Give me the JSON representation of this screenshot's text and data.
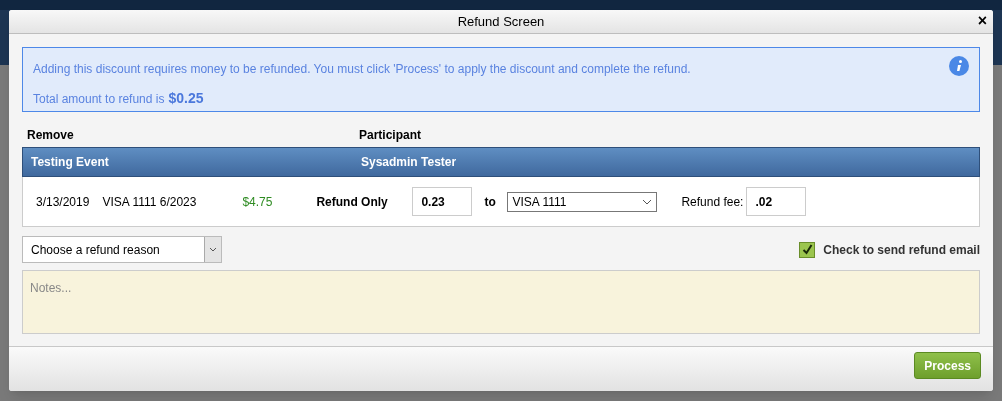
{
  "dialog": {
    "title": "Refund Screen",
    "close": "×",
    "notice": {
      "message": "Adding this discount requires money to be refunded. You must click 'Process' to apply the discount and complete the refund.",
      "total_label": "Total amount to refund is",
      "total_amount": "$0.25"
    },
    "table": {
      "columns": [
        "Remove",
        "Participant"
      ],
      "group": {
        "event": "Testing Event",
        "participant": "Sysadmin Tester"
      },
      "rows": [
        {
          "date": "3/13/2019",
          "card": "VISA 1111 6/2023",
          "amount": "$4.75",
          "action": "Refund Only",
          "refund_amount": "0.23",
          "to_label": "to",
          "destination": "VISA 1111",
          "fee_label": "Refund fee:",
          "fee": ".02"
        }
      ]
    },
    "reason": {
      "value": "Choose a refund reason"
    },
    "email": {
      "label": "Check to send refund email",
      "checked": true
    },
    "notes": {
      "placeholder": "Notes..."
    },
    "buttons": [
      {
        "label": "Process"
      }
    ]
  }
}
